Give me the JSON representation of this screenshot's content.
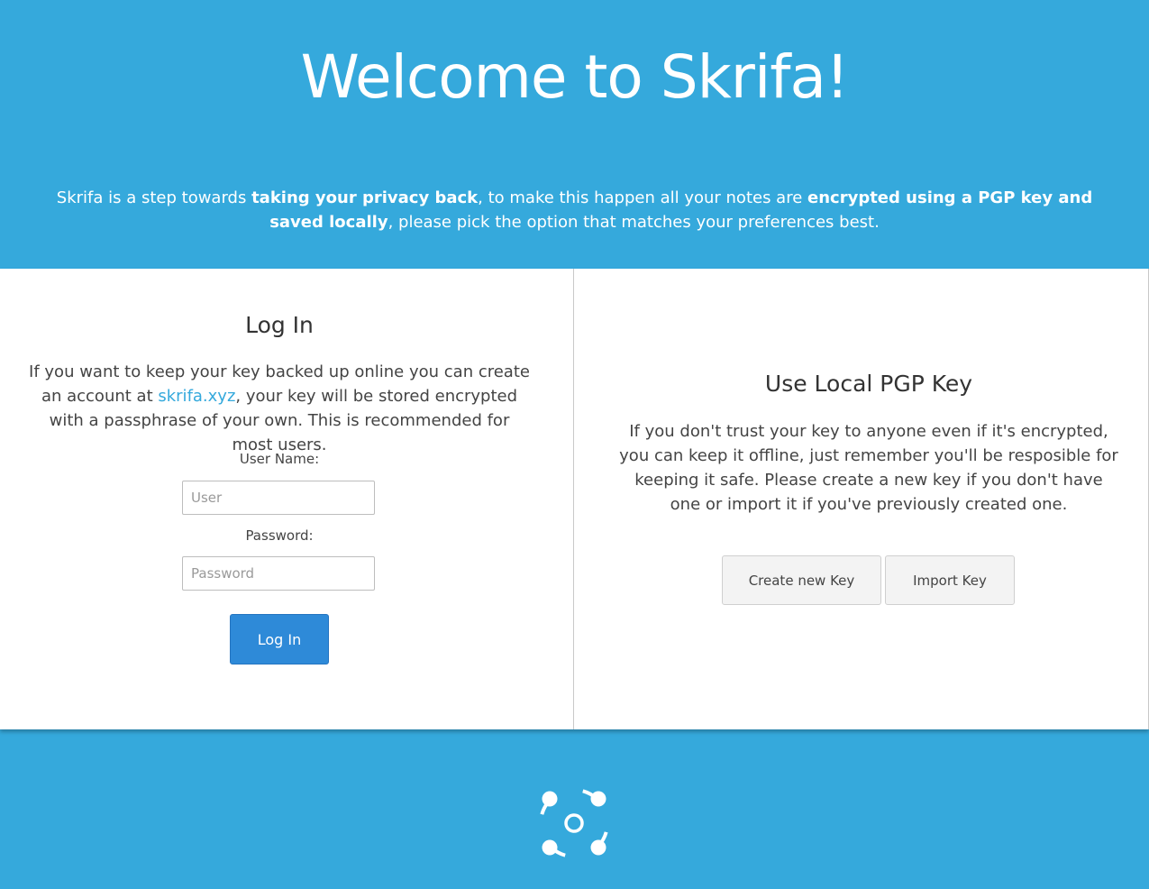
{
  "header": {
    "title": "Welcome to Skrifa!",
    "intro": {
      "part1": "Skrifa is a step towards ",
      "bold1": "taking your privacy back",
      "part2": ", to make this happen all your notes are ",
      "bold2": "encrypted using a PGP key and saved locally",
      "part3": ", please pick the option that matches your preferences best."
    }
  },
  "login": {
    "title": "Log In",
    "desc_before": "If you want to keep your key backed up online you can create an account at ",
    "link_text": "skrifa.xyz",
    "desc_after": ", your key will be stored encrypted with a passphrase of your own. This is recommended for most users.",
    "username_label": "User Name:",
    "username_placeholder": "User",
    "username_value": "",
    "password_label": "Password:",
    "password_placeholder": "Password",
    "password_value": "",
    "submit_label": "Log In"
  },
  "local_key": {
    "title": "Use Local PGP Key",
    "desc": "If you don't trust your key to anyone even if it's encrypted, you can keep it offline, just remember you'll be resposible for keeping it safe. Please create a new key if you don't have one or import it if you've previously created one.",
    "create_label": "Create new Key",
    "import_label": "Import Key"
  },
  "footer": {
    "logo_icon": "skrifa-logo-icon"
  },
  "colors": {
    "brand": "#35a9dc",
    "primary_button": "#2e8ad8",
    "link": "#35a9dc"
  }
}
